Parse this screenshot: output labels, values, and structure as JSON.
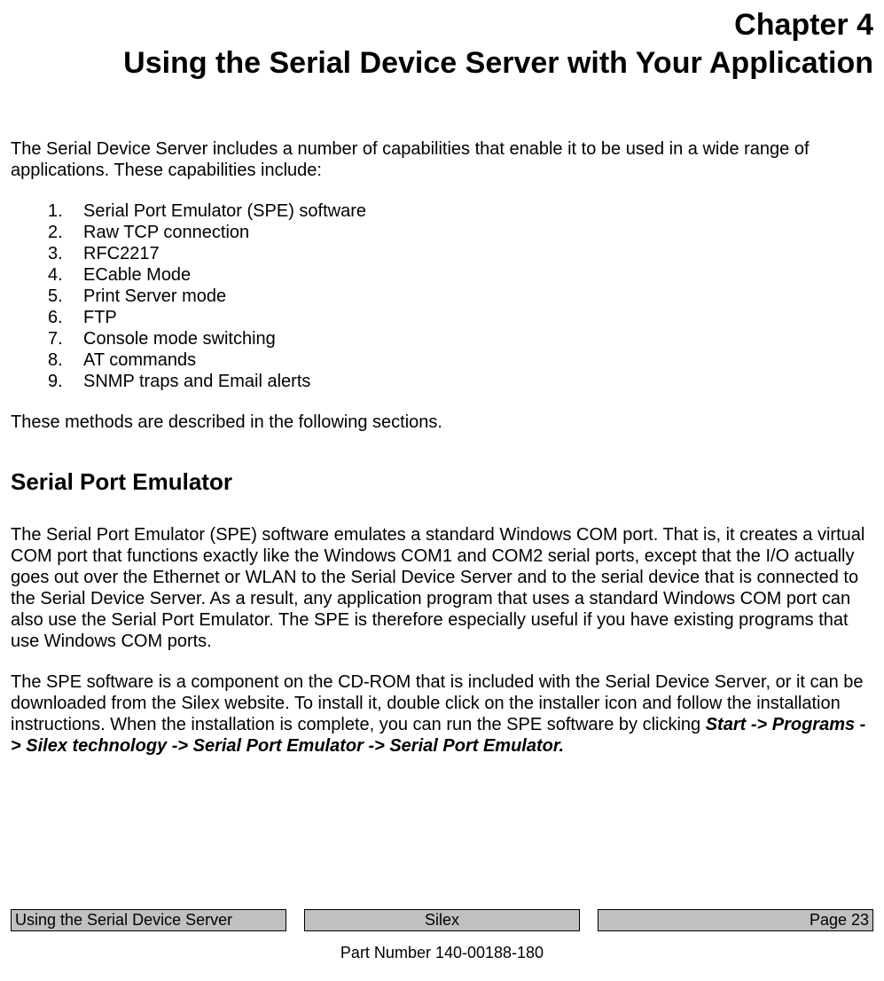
{
  "chapter_label": "Chapter 4",
  "chapter_title": "Using the Serial Device Server with Your Application",
  "intro": "The Serial Device Server includes a number of capabilities that enable it to be used in a wide range of applications.  These capabilities include:",
  "list": [
    {
      "n": "1.",
      "t": "Serial Port Emulator (SPE) software"
    },
    {
      "n": "2.",
      "t": "Raw TCP connection"
    },
    {
      "n": "3.",
      "t": "RFC2217"
    },
    {
      "n": "4.",
      "t": "ECable Mode"
    },
    {
      "n": "5.",
      "t": "Print Server mode"
    },
    {
      "n": "6.",
      "t": "FTP"
    },
    {
      "n": "7.",
      "t": "Console mode switching"
    },
    {
      "n": "8.",
      "t": "AT commands"
    },
    {
      "n": "9.",
      "t": "SNMP traps and Email alerts"
    }
  ],
  "methods_line": "These methods are described in the following sections.",
  "section_heading": "Serial Port Emulator",
  "para1": "The Serial Port Emulator (SPE) software emulates a standard Windows COM port.  That is, it creates a virtual COM port that functions exactly like the Windows COM1 and COM2 serial ports, except that the I/O actually goes out over the Ethernet or WLAN to the Serial Device Server and to the serial device that is connected to the Serial Device Server.  As a result, any application program that uses a standard Windows COM port can also use the Serial Port Emulator.  The SPE is therefore especially useful if you have existing programs that use Windows COM ports.",
  "para2_run1": "The SPE software is a component on the CD-ROM that is included with the Serial Device Server, or it can be downloaded from the Silex website.  To install it, double click on the installer icon and follow the installation instructions. When the installation is complete, you can run the SPE software by clicking ",
  "para2_emph": "Start -> Programs -> Silex technology -> Serial Port Emulator -> Serial Port Emulator.",
  "footer": {
    "left": "Using the Serial Device Server",
    "center": "Silex",
    "right": "Page 23",
    "partnum": "Part Number 140-00188-180"
  }
}
